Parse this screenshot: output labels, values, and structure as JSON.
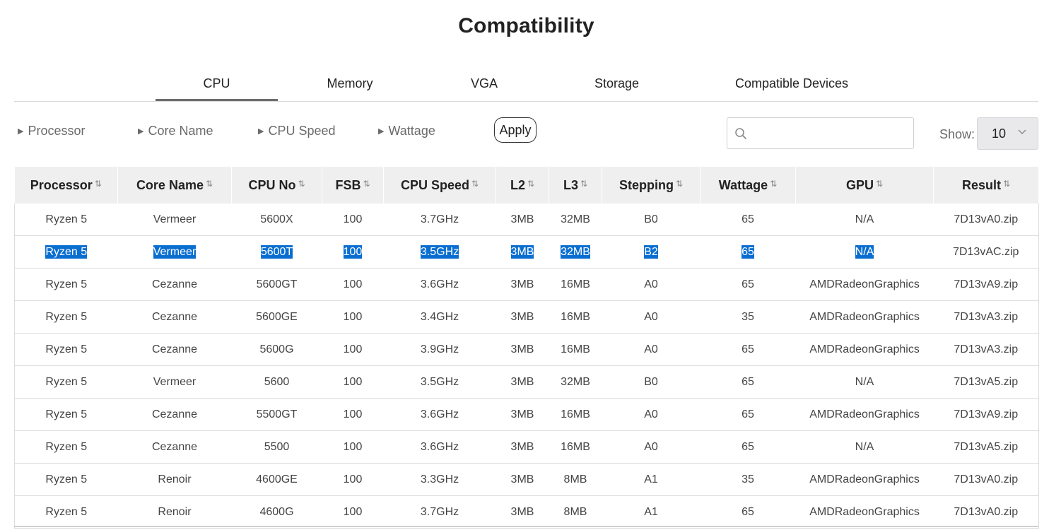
{
  "page": {
    "title": "Compatibility"
  },
  "tabs": [
    {
      "label": "CPU",
      "active": true
    },
    {
      "label": "Memory",
      "active": false
    },
    {
      "label": "VGA",
      "active": false
    },
    {
      "label": "Storage",
      "active": false
    },
    {
      "label": "Compatible Devices",
      "active": false
    }
  ],
  "filters": {
    "items": [
      {
        "label": "Processor"
      },
      {
        "label": "Core Name"
      },
      {
        "label": "CPU Speed"
      },
      {
        "label": "Wattage"
      }
    ],
    "apply_label": "Apply"
  },
  "search": {
    "value": "",
    "placeholder": "",
    "icon": "search-icon"
  },
  "show": {
    "label": "Show:",
    "selected": "10",
    "icon": "chevron-down-icon"
  },
  "table": {
    "columns": [
      "Processor",
      "Core Name",
      "CPU No",
      "FSB",
      "CPU Speed",
      "L2",
      "L3",
      "Stepping",
      "Wattage",
      "GPU",
      "Result"
    ],
    "sort_icon": "⇅",
    "rows": [
      {
        "selected": false,
        "cells": [
          "Ryzen 5",
          "Vermeer",
          "5600X",
          "100",
          "3.7GHz",
          "3MB",
          "32MB",
          "B0",
          "65",
          "N/A",
          "7D13vA0.zip"
        ]
      },
      {
        "selected": true,
        "cells": [
          "Ryzen 5",
          "Vermeer",
          "5600T",
          "100",
          "3.5GHz",
          "3MB",
          "32MB",
          "B2",
          "65",
          "N/A",
          "7D13vAC.zip"
        ]
      },
      {
        "selected": false,
        "cells": [
          "Ryzen 5",
          "Cezanne",
          "5600GT",
          "100",
          "3.6GHz",
          "3MB",
          "16MB",
          "A0",
          "65",
          "AMDRadeonGraphics",
          "7D13vA9.zip"
        ]
      },
      {
        "selected": false,
        "cells": [
          "Ryzen 5",
          "Cezanne",
          "5600GE",
          "100",
          "3.4GHz",
          "3MB",
          "16MB",
          "A0",
          "35",
          "AMDRadeonGraphics",
          "7D13vA3.zip"
        ]
      },
      {
        "selected": false,
        "cells": [
          "Ryzen 5",
          "Cezanne",
          "5600G",
          "100",
          "3.9GHz",
          "3MB",
          "16MB",
          "A0",
          "65",
          "AMDRadeonGraphics",
          "7D13vA3.zip"
        ]
      },
      {
        "selected": false,
        "cells": [
          "Ryzen 5",
          "Vermeer",
          "5600",
          "100",
          "3.5GHz",
          "3MB",
          "32MB",
          "B0",
          "65",
          "N/A",
          "7D13vA5.zip"
        ]
      },
      {
        "selected": false,
        "cells": [
          "Ryzen 5",
          "Cezanne",
          "5500GT",
          "100",
          "3.6GHz",
          "3MB",
          "16MB",
          "A0",
          "65",
          "AMDRadeonGraphics",
          "7D13vA9.zip"
        ]
      },
      {
        "selected": false,
        "cells": [
          "Ryzen 5",
          "Cezanne",
          "5500",
          "100",
          "3.6GHz",
          "3MB",
          "16MB",
          "A0",
          "65",
          "N/A",
          "7D13vA5.zip"
        ]
      },
      {
        "selected": false,
        "cells": [
          "Ryzen 5",
          "Renoir",
          "4600GE",
          "100",
          "3.3GHz",
          "3MB",
          "8MB",
          "A1",
          "35",
          "AMDRadeonGraphics",
          "7D13vA0.zip"
        ]
      },
      {
        "selected": false,
        "cells": [
          "Ryzen 5",
          "Renoir",
          "4600G",
          "100",
          "3.7GHz",
          "3MB",
          "8MB",
          "A1",
          "65",
          "AMDRadeonGraphics",
          "7D13vA0.zip"
        ]
      }
    ]
  },
  "colors": {
    "selection": "#0a6ed1",
    "header_bg": "#efefef"
  }
}
